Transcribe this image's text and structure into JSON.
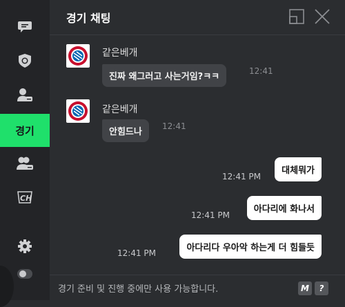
{
  "header": {
    "title": "경기 채팅"
  },
  "sidebar": {
    "items": [
      {
        "icon": "chat-bubble-icon",
        "active": false
      },
      {
        "icon": "shield-ball-icon",
        "active": false
      },
      {
        "icon": "user-chat-icon",
        "active": false
      },
      {
        "label": "경기",
        "active": true
      },
      {
        "icon": "group-chat-icon",
        "active": false
      },
      {
        "icon": "ch-logo-icon",
        "active": false
      },
      {
        "icon": "gear-icon",
        "active": false
      },
      {
        "icon": "toggle-icon",
        "active": false
      }
    ]
  },
  "messages": [
    {
      "direction": "in",
      "sender": "같은베개",
      "text": "진짜 왜그러고 사는거임?ㅋㅋ",
      "time": "12:41",
      "avatar": "fc-bayern-logo-icon"
    },
    {
      "direction": "in",
      "sender": "같은베개",
      "text": "안힘드나",
      "time": "12:41",
      "avatar": "fc-bayern-logo-icon"
    },
    {
      "direction": "out",
      "text": "대체뭐가",
      "time": "12:41 PM"
    },
    {
      "direction": "out",
      "text": "아다리에 화나서",
      "time": "12:41 PM"
    },
    {
      "direction": "out",
      "text": "아다리다 우아악 하는게 더 힘들듯",
      "time": "12:41 PM"
    }
  ],
  "footer": {
    "notice": "경기 준비 및 진행 중에만 사용 가능합니다.",
    "m_button": "M",
    "help_button": "?"
  },
  "colors": {
    "accent": "#1fe06b",
    "background": "#2b2d30",
    "sidebar": "#232427",
    "bubble_in": "#414347",
    "bubble_out": "#ffffff"
  }
}
